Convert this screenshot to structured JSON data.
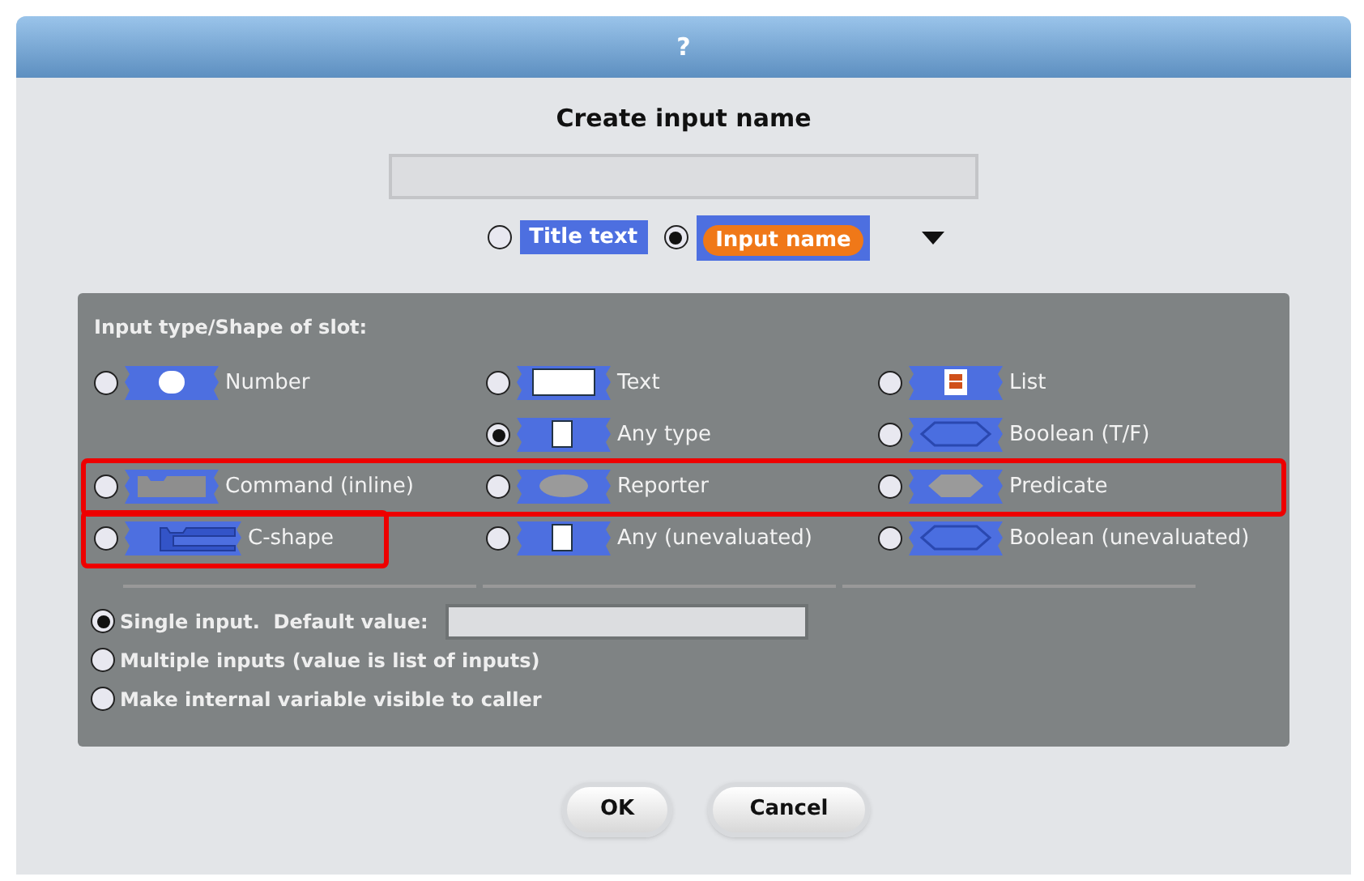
{
  "window": {
    "title": "?"
  },
  "heading": "Create input name",
  "name_kinds": [
    {
      "label": "Title text",
      "selected": false,
      "kind": "title"
    },
    {
      "label": "Input name",
      "selected": true,
      "kind": "input"
    }
  ],
  "slot_panel": {
    "title": "Input type/Shape of slot:",
    "rows": [
      {
        "highlighted": false,
        "cells": [
          {
            "label": "Number",
            "kind": "number",
            "selected": false,
            "highlighted": false
          },
          {
            "label": "Text",
            "kind": "text",
            "selected": false,
            "highlighted": false
          },
          {
            "label": "List",
            "kind": "list",
            "selected": false,
            "highlighted": false
          }
        ]
      },
      {
        "highlighted": false,
        "cells": [
          null,
          {
            "label": "Any type",
            "kind": "any",
            "selected": true,
            "highlighted": false
          },
          {
            "label": "Boolean (T/F)",
            "kind": "boolean",
            "selected": false,
            "highlighted": false
          }
        ]
      },
      {
        "highlighted": true,
        "cells": [
          {
            "label": "Command (inline)",
            "kind": "command",
            "selected": false,
            "highlighted": false
          },
          {
            "label": "Reporter",
            "kind": "reporter",
            "selected": false,
            "highlighted": false
          },
          {
            "label": "Predicate",
            "kind": "predicate",
            "selected": false,
            "highlighted": false
          }
        ]
      },
      {
        "highlighted": false,
        "cells": [
          {
            "label": "C-shape",
            "kind": "cshape",
            "selected": false,
            "highlighted": true
          },
          {
            "label": "Any (unevaluated)",
            "kind": "any",
            "selected": false,
            "highlighted": false
          },
          {
            "label": "Boolean (unevaluated)",
            "kind": "boolean",
            "selected": false,
            "highlighted": false
          }
        ]
      }
    ],
    "options": [
      {
        "label": "Single input.  Default value:",
        "selected": true,
        "has_field": true
      },
      {
        "label": "Multiple inputs (value is list of inputs)",
        "selected": false,
        "has_field": false
      },
      {
        "label": "Make internal variable visible to caller",
        "selected": false,
        "has_field": false
      }
    ]
  },
  "buttons": [
    "OK",
    "Cancel"
  ]
}
